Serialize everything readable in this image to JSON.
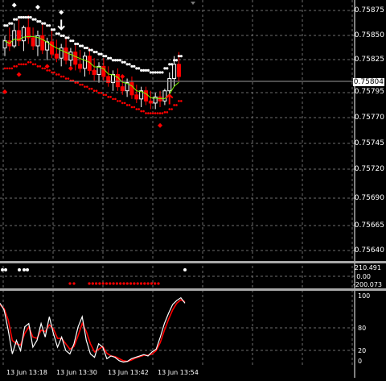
{
  "colors": {
    "background": "#000000",
    "grid": "#6e6e6e",
    "bull": "#ffffff",
    "bear": "#ff0000",
    "sma": "#7cfc00",
    "stoch_main": "#ffffff",
    "stoch_signal": "#ff0000",
    "separator": "#a9a9a9"
  },
  "price_axis": {
    "labels": [
      "0.75875",
      "0.75850",
      "0.75825",
      "0.75795",
      "0.75770",
      "0.75745",
      "0.75720",
      "0.75690",
      "0.75665",
      "0.75640"
    ],
    "current_price": "0.75804"
  },
  "middle_pane": {
    "labels": [
      "210.491",
      "0.00",
      "-200.073"
    ],
    "upper_dots_count": 6,
    "lower_dots_count": 23
  },
  "stoch_pane": {
    "labels": [
      "100",
      "80",
      "20",
      "0"
    ]
  },
  "time_axis": {
    "labels": [
      "13 Jun 13:18",
      "13 Jun 13:30",
      "13 Jun 13:42",
      "13 Jun 13:54"
    ]
  },
  "chart_data": [
    {
      "type": "candlestick",
      "ylim": [
        0.7563,
        0.75885
      ],
      "candles": [
        {
          "o": 0.75838,
          "h": 0.7585,
          "l": 0.7583,
          "c": 0.75845
        },
        {
          "o": 0.75845,
          "h": 0.75858,
          "l": 0.75835,
          "c": 0.7584
        },
        {
          "o": 0.7584,
          "h": 0.75862,
          "l": 0.75838,
          "c": 0.75855
        },
        {
          "o": 0.75855,
          "h": 0.75866,
          "l": 0.7584,
          "c": 0.75845
        },
        {
          "o": 0.75845,
          "h": 0.7586,
          "l": 0.75835,
          "c": 0.75858
        },
        {
          "o": 0.75858,
          "h": 0.7587,
          "l": 0.75842,
          "c": 0.75848
        },
        {
          "o": 0.75848,
          "h": 0.75858,
          "l": 0.75836,
          "c": 0.7584
        },
        {
          "o": 0.7584,
          "h": 0.75855,
          "l": 0.7583,
          "c": 0.7585
        },
        {
          "o": 0.7585,
          "h": 0.75862,
          "l": 0.75832,
          "c": 0.75836
        },
        {
          "o": 0.75836,
          "h": 0.75848,
          "l": 0.75826,
          "c": 0.75844
        },
        {
          "o": 0.75844,
          "h": 0.75856,
          "l": 0.75828,
          "c": 0.75832
        },
        {
          "o": 0.75832,
          "h": 0.75846,
          "l": 0.75824,
          "c": 0.75828
        },
        {
          "o": 0.75828,
          "h": 0.75842,
          "l": 0.7582,
          "c": 0.75838
        },
        {
          "o": 0.75838,
          "h": 0.75848,
          "l": 0.75822,
          "c": 0.75826
        },
        {
          "o": 0.75826,
          "h": 0.75838,
          "l": 0.75818,
          "c": 0.75834
        },
        {
          "o": 0.75834,
          "h": 0.75842,
          "l": 0.75816,
          "c": 0.75822
        },
        {
          "o": 0.75822,
          "h": 0.75836,
          "l": 0.75814,
          "c": 0.75818
        },
        {
          "o": 0.75818,
          "h": 0.75834,
          "l": 0.7581,
          "c": 0.7583
        },
        {
          "o": 0.7583,
          "h": 0.75838,
          "l": 0.75812,
          "c": 0.75816
        },
        {
          "o": 0.75816,
          "h": 0.75828,
          "l": 0.75806,
          "c": 0.75812
        },
        {
          "o": 0.75812,
          "h": 0.75824,
          "l": 0.75804,
          "c": 0.7582
        },
        {
          "o": 0.7582,
          "h": 0.75828,
          "l": 0.75806,
          "c": 0.7581
        },
        {
          "o": 0.7581,
          "h": 0.7582,
          "l": 0.758,
          "c": 0.75804
        },
        {
          "o": 0.75804,
          "h": 0.75816,
          "l": 0.75796,
          "c": 0.75812
        },
        {
          "o": 0.75812,
          "h": 0.75818,
          "l": 0.75796,
          "c": 0.758
        },
        {
          "o": 0.758,
          "h": 0.7581,
          "l": 0.75792,
          "c": 0.75796
        },
        {
          "o": 0.75796,
          "h": 0.75808,
          "l": 0.7579,
          "c": 0.75804
        },
        {
          "o": 0.75804,
          "h": 0.7581,
          "l": 0.75788,
          "c": 0.75792
        },
        {
          "o": 0.75792,
          "h": 0.75802,
          "l": 0.75784,
          "c": 0.75788
        },
        {
          "o": 0.75788,
          "h": 0.758,
          "l": 0.7578,
          "c": 0.75796
        },
        {
          "o": 0.75796,
          "h": 0.758,
          "l": 0.75782,
          "c": 0.75786
        },
        {
          "o": 0.75786,
          "h": 0.75796,
          "l": 0.75778,
          "c": 0.75784
        },
        {
          "o": 0.75784,
          "h": 0.75794,
          "l": 0.75778,
          "c": 0.7579
        },
        {
          "o": 0.7579,
          "h": 0.75796,
          "l": 0.7578,
          "c": 0.75786
        },
        {
          "o": 0.75786,
          "h": 0.75798,
          "l": 0.75782,
          "c": 0.75796
        },
        {
          "o": 0.75796,
          "h": 0.75814,
          "l": 0.75788,
          "c": 0.75808
        },
        {
          "o": 0.75808,
          "h": 0.7583,
          "l": 0.758,
          "c": 0.75822
        },
        {
          "o": 0.75822,
          "h": 0.75834,
          "l": 0.75805,
          "c": 0.7581
        }
      ],
      "upper_band": [
        0.7586,
        0.75862,
        0.75866,
        0.75868,
        0.75868,
        0.75868,
        0.75866,
        0.75864,
        0.75862,
        0.7586,
        0.75856,
        0.75852,
        0.7585,
        0.75848,
        0.75845,
        0.75842,
        0.7584,
        0.75838,
        0.75836,
        0.75834,
        0.75832,
        0.7583,
        0.75828,
        0.75826,
        0.75826,
        0.75824,
        0.75822,
        0.7582,
        0.75818,
        0.75816,
        0.75816,
        0.75814,
        0.75814,
        0.75814,
        0.75818,
        0.75822,
        0.75826,
        0.7583
      ],
      "lower_band": [
        0.75818,
        0.75818,
        0.7582,
        0.75822,
        0.75822,
        0.75824,
        0.75822,
        0.7582,
        0.75818,
        0.75816,
        0.75814,
        0.75812,
        0.7581,
        0.75808,
        0.75806,
        0.75804,
        0.75802,
        0.758,
        0.75798,
        0.75796,
        0.75794,
        0.75792,
        0.7579,
        0.75788,
        0.75786,
        0.75784,
        0.75782,
        0.7578,
        0.75778,
        0.75776,
        0.75774,
        0.75774,
        0.75774,
        0.75774,
        0.75775,
        0.75778,
        0.75782,
        0.75786
      ],
      "diamonds_white": [
        [
          2,
          0.7588
        ],
        [
          7,
          0.75878
        ],
        [
          12,
          0.75873
        ]
      ],
      "diamonds_red": [
        [
          0,
          0.75795
        ],
        [
          3,
          0.75812
        ],
        [
          9,
          0.7582
        ],
        [
          14,
          0.75818
        ],
        [
          19,
          0.75815
        ],
        [
          25,
          0.7581
        ],
        [
          33,
          0.75762
        ]
      ],
      "arrow_down_index": 12,
      "arrow_up_index": 35
    },
    {
      "type": "line",
      "name": "stochastic",
      "ylim": [
        0,
        100
      ],
      "main": [
        90,
        80,
        50,
        15,
        35,
        20,
        55,
        60,
        25,
        35,
        60,
        40,
        70,
        45,
        25,
        40,
        20,
        15,
        30,
        55,
        70,
        35,
        15,
        10,
        30,
        25,
        8,
        12,
        10,
        5,
        3,
        4,
        8,
        10,
        12,
        14,
        12,
        18,
        22,
        40,
        60,
        75,
        88,
        94,
        98,
        90
      ],
      "signal": [
        88,
        82,
        65,
        35,
        30,
        28,
        45,
        55,
        40,
        38,
        50,
        48,
        58,
        52,
        38,
        38,
        30,
        22,
        26,
        42,
        60,
        48,
        30,
        18,
        22,
        26,
        16,
        12,
        11,
        8,
        5,
        4,
        6,
        9,
        11,
        13,
        13,
        15,
        20,
        32,
        50,
        66,
        80,
        90,
        95,
        92
      ]
    }
  ]
}
